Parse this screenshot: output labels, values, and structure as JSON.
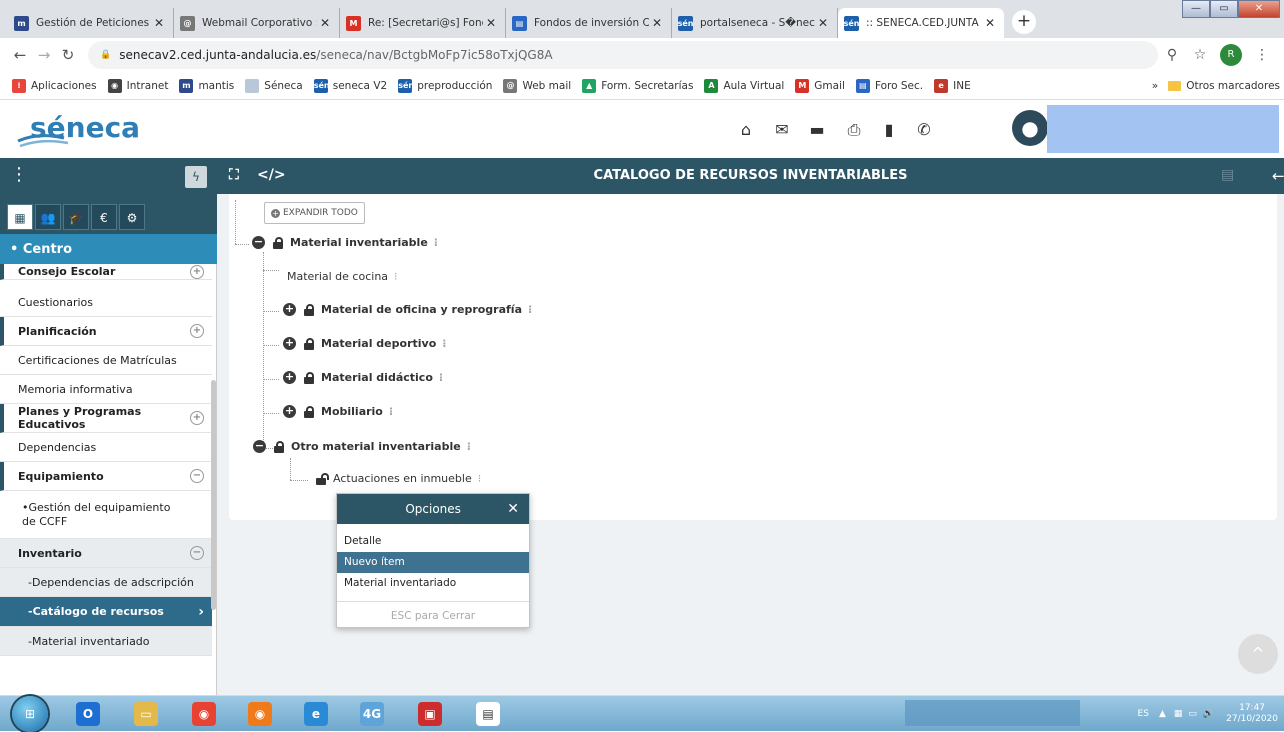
{
  "browser": {
    "tabs": [
      {
        "title": "Gestión de Peticiones",
        "icon": "mantis-icon",
        "color": "#2f4a8a",
        "glyph": "m"
      },
      {
        "title": "Webmail Corporativo :: F",
        "icon": "webmail-icon",
        "color": "#777777",
        "glyph": "@"
      },
      {
        "title": "Re: [Secretari@s] Fondos",
        "icon": "gmail-icon",
        "color": "#d93025",
        "glyph": "M"
      },
      {
        "title": "Fondos de inversión Cov",
        "icon": "forum-icon",
        "color": "#2a66c4",
        "glyph": "▤"
      },
      {
        "title": "portalseneca - S�neca",
        "icon": "seneca-icon",
        "color": "#1d5fa8",
        "glyph": "sén"
      },
      {
        "title": ":: SENECA.CED.JUNTA DE",
        "icon": "seneca-icon",
        "color": "#1d5fa8",
        "glyph": "sén"
      }
    ],
    "tab_close": "✕",
    "new_tab": "+",
    "window_controls": {
      "minimize": "—",
      "maximize": "▭",
      "close": "✕"
    },
    "url_host": "senecav2.ced.junta-andalucia.es",
    "url_path": "/seneca/nav/BctgbMoFp7ic58oTxjQG8A",
    "profile_initial": "R",
    "bookmarks": [
      {
        "label": "Aplicaciones",
        "icon": "apps-icon",
        "color": "#e8453c",
        "glyph": "⁞"
      },
      {
        "label": "Intranet",
        "icon": "intranet-icon",
        "color": "#444444",
        "glyph": "◉"
      },
      {
        "label": "mantis",
        "icon": "mantis-icon",
        "color": "#2f4a8a",
        "glyph": "m"
      },
      {
        "label": "Séneca",
        "icon": "seneca-bm-icon",
        "color": "#b8c8d8",
        "glyph": ""
      },
      {
        "label": "seneca V2",
        "icon": "seneca-icon",
        "color": "#1d5fa8",
        "glyph": "sén"
      },
      {
        "label": "preproducción",
        "icon": "seneca-icon",
        "color": "#1d5fa8",
        "glyph": "sén"
      },
      {
        "label": "Web mail",
        "icon": "webmail-icon",
        "color": "#777777",
        "glyph": "@"
      },
      {
        "label": "Form. Secretarías",
        "icon": "drive-icon",
        "color": "#1fa463",
        "glyph": "▲"
      },
      {
        "label": "Aula Virtual",
        "icon": "aula-icon",
        "color": "#1e8a3c",
        "glyph": "A"
      },
      {
        "label": "Gmail",
        "icon": "gmail-icon",
        "color": "#d93025",
        "glyph": "M"
      },
      {
        "label": "Foro Sec.",
        "icon": "forum-icon",
        "color": "#2a66c4",
        "glyph": "▤"
      },
      {
        "label": "INE",
        "icon": "ine-icon",
        "color": "#c0392b",
        "glyph": "e"
      }
    ],
    "bookmarks_more": "»",
    "other_bookmarks": "Otros marcadores"
  },
  "app": {
    "logo_text": "séneca",
    "logo_color": "#2f7fb6",
    "header_icons": [
      "home-icon",
      "mail-icon",
      "folder-icon",
      "print-icon",
      "copy-icon",
      "phone-icon"
    ],
    "header_glyphs": [
      "⌂",
      "✉",
      "▬",
      "⎙",
      "▮",
      "✆"
    ],
    "toolbar_title": "CATALOGO DE RECURSOS INVENTARIABLES",
    "sidebar_section": "• Centro",
    "sidebar_tabs": [
      "▦",
      "👥",
      "🎓",
      "€",
      "⚙"
    ],
    "menu": [
      {
        "label": "Consejo Escolar",
        "toggle": "+",
        "bold": true
      },
      {
        "label": "Cuestionarios",
        "toggle": "",
        "bold": false
      },
      {
        "label": "Planificación",
        "toggle": "+",
        "bold": true
      },
      {
        "label": "Certificaciones de Matrículas",
        "toggle": "",
        "bold": false
      },
      {
        "label": "Memoria informativa",
        "toggle": "",
        "bold": false
      },
      {
        "label": "Planes y Programas Educativos",
        "toggle": "+",
        "bold": true
      },
      {
        "label": "Dependencias",
        "toggle": "",
        "bold": false
      },
      {
        "label": "Equipamiento",
        "toggle": "−",
        "bold": true
      },
      {
        "label": "•Gestión del equipamiento de CCFF",
        "toggle": "",
        "bold": false
      },
      {
        "label": "Inventario",
        "toggle": "−",
        "bold": true
      },
      {
        "label": "-Dependencias de adscripción",
        "toggle": "",
        "bold": false
      },
      {
        "label": "-Catálogo de recursos",
        "toggle": "›",
        "bold": true
      },
      {
        "label": "-Material inventariado",
        "toggle": "",
        "bold": false
      }
    ],
    "expand_all": "EXPANDIR TODO",
    "tree": [
      {
        "label": "Material inventariable",
        "toggle": "−",
        "lock": "closed",
        "bold": true
      },
      {
        "label": "Material de cocina",
        "toggle": "",
        "lock": "",
        "bold": false
      },
      {
        "label": "Material de oficina y reprografía",
        "toggle": "+",
        "lock": "closed",
        "bold": true
      },
      {
        "label": "Material deportivo",
        "toggle": "+",
        "lock": "closed",
        "bold": true
      },
      {
        "label": "Material didáctico",
        "toggle": "+",
        "lock": "closed",
        "bold": true
      },
      {
        "label": "Mobiliario",
        "toggle": "+",
        "lock": "closed",
        "bold": true
      },
      {
        "label": "Otro material inventariable",
        "toggle": "−",
        "lock": "closed",
        "bold": true
      },
      {
        "label": "Actuaciones en inmueble",
        "toggle": "",
        "lock": "open",
        "bold": false
      }
    ],
    "kebab": "⁝",
    "popup": {
      "title": "Opciones",
      "close": "✕",
      "items": [
        "Detalle",
        "Nuevo ítem",
        "Material inventariado"
      ],
      "selected": "Nuevo ítem",
      "esc": "ESC para Cerrar"
    }
  },
  "taskbar": {
    "apps": [
      "outlook-icon",
      "explorer-icon",
      "chrome-icon",
      "firefox-icon",
      "ie-icon",
      "4g-icon",
      "shield-icon",
      "document-icon"
    ],
    "app_colors": [
      "#1e6fd1",
      "#e3b94a",
      "#e84232",
      "#f07a1a",
      "#2b8ad6",
      "#5fa4d8",
      "#cc2c2c",
      "#ffffff"
    ],
    "lang": "ES",
    "time": "17:47",
    "date": "27/10/2020"
  }
}
